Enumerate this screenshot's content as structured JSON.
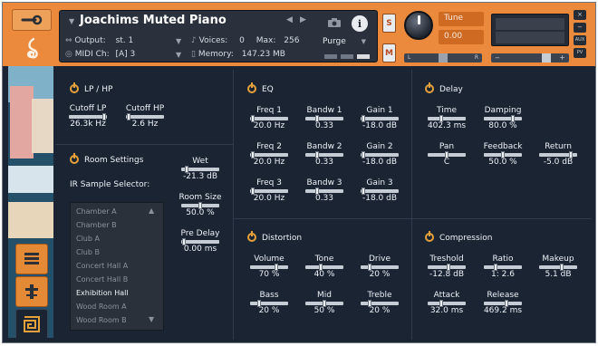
{
  "header": {
    "title": "Joachims Muted Piano",
    "output_label": "Output:",
    "output_value": "st. 1",
    "midi_label": "MIDI Ch:",
    "midi_value": "[A]  3",
    "voices_label": "Voices:",
    "voices_value": "0",
    "max_label": "Max:",
    "max_value": "256",
    "memory_label": "Memory:",
    "memory_value": "147.23 MB",
    "purge_label": "Purge",
    "s_label": "S",
    "m_label": "M",
    "tune_label": "Tune",
    "tune_value": "0.00",
    "pan_left": "L",
    "pan_right": "R",
    "side_buttons": [
      "×",
      "−",
      "AUX",
      "PV"
    ]
  },
  "sections": {
    "lp_hp": {
      "title": "LP / HP",
      "controls": [
        {
          "label": "Cutoff LP",
          "value": "26.3k Hz",
          "pos": 0.98
        },
        {
          "label": "Cutoff HP",
          "value": "2.6 Hz",
          "pos": 0.02
        }
      ]
    },
    "room": {
      "title": "Room Settings",
      "ir_label": "IR Sample Selector:",
      "samples": [
        "Chamber A",
        "Chamber B",
        "Club A",
        "Club B",
        "Concert Hall A",
        "Concert Hall B",
        "Exhibition Hall",
        "Wood Room A",
        "Wood Room B"
      ],
      "selected_sample": "Exhibition Hall",
      "controls": [
        {
          "label": "Wet",
          "value": "-21.3 dB",
          "pos": 0.1
        },
        {
          "label": "Room Size",
          "value": "50.0 %",
          "pos": 0.5
        },
        {
          "label": "Pre Delay",
          "value": "0.00 ms",
          "pos": 0.02
        }
      ]
    },
    "eq": {
      "title": "EQ",
      "controls": [
        {
          "label": "Freq 1",
          "value": "20.0 Hz",
          "pos": 0.02
        },
        {
          "label": "Bandw 1",
          "value": "0.33",
          "pos": 0.3
        },
        {
          "label": "Gain 1",
          "value": "-18.0 dB",
          "pos": 0.02
        },
        {
          "label": "Freq 2",
          "value": "20.0 Hz",
          "pos": 0.02
        },
        {
          "label": "Bandw 2",
          "value": "0.33",
          "pos": 0.3
        },
        {
          "label": "Gain 2",
          "value": "-18.0 dB",
          "pos": 0.02
        },
        {
          "label": "Freq 3",
          "value": "20.0 Hz",
          "pos": 0.02
        },
        {
          "label": "Bandw 3",
          "value": "0.33",
          "pos": 0.3
        },
        {
          "label": "Gain 3",
          "value": "-18.0 dB",
          "pos": 0.02
        }
      ]
    },
    "delay": {
      "title": "Delay",
      "controls": [
        {
          "label": "Time",
          "value": "402.3 ms",
          "pos": 0.35
        },
        {
          "label": "Damping",
          "value": "80.0 %",
          "pos": 0.8
        },
        {
          "label": "Pan",
          "value": "C",
          "pos": 0.5
        },
        {
          "label": "Feedback",
          "value": "50.0 %",
          "pos": 0.5
        },
        {
          "label": "Return",
          "value": "-5.0 dB",
          "pos": 0.88
        }
      ]
    },
    "distortion": {
      "title": "Distortion",
      "controls": [
        {
          "label": "Volume",
          "value": "70 %",
          "pos": 0.7
        },
        {
          "label": "Tone",
          "value": "40 %",
          "pos": 0.4
        },
        {
          "label": "Drive",
          "value": "20 %",
          "pos": 0.2
        },
        {
          "label": "Bass",
          "value": "20 %",
          "pos": 0.2
        },
        {
          "label": "Mid",
          "value": "50 %",
          "pos": 0.5
        },
        {
          "label": "Treble",
          "value": "20 %",
          "pos": 0.2
        }
      ]
    },
    "compression": {
      "title": "Compression",
      "controls": [
        {
          "label": "Treshold",
          "value": "-12.8 dB",
          "pos": 0.55
        },
        {
          "label": "Ratio",
          "value": "1: 2.6",
          "pos": 0.3
        },
        {
          "label": "Makeup",
          "value": "5.1 dB",
          "pos": 0.6
        },
        {
          "label": "Attack",
          "value": "32.0 ms",
          "pos": 0.35
        },
        {
          "label": "Release",
          "value": "469.2 ms",
          "pos": 0.6
        }
      ]
    }
  }
}
